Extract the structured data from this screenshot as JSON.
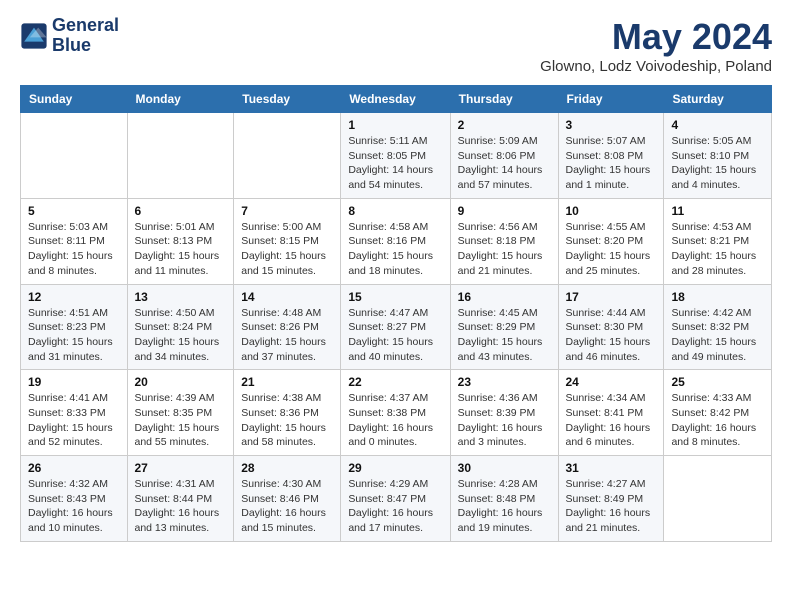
{
  "header": {
    "logo_line1": "General",
    "logo_line2": "Blue",
    "month_year": "May 2024",
    "location": "Glowno, Lodz Voivodeship, Poland"
  },
  "days_of_week": [
    "Sunday",
    "Monday",
    "Tuesday",
    "Wednesday",
    "Thursday",
    "Friday",
    "Saturday"
  ],
  "weeks": [
    [
      {
        "day": "",
        "sunrise": "",
        "sunset": "",
        "daylight": ""
      },
      {
        "day": "",
        "sunrise": "",
        "sunset": "",
        "daylight": ""
      },
      {
        "day": "",
        "sunrise": "",
        "sunset": "",
        "daylight": ""
      },
      {
        "day": "1",
        "sunrise": "Sunrise: 5:11 AM",
        "sunset": "Sunset: 8:05 PM",
        "daylight": "Daylight: 14 hours and 54 minutes."
      },
      {
        "day": "2",
        "sunrise": "Sunrise: 5:09 AM",
        "sunset": "Sunset: 8:06 PM",
        "daylight": "Daylight: 14 hours and 57 minutes."
      },
      {
        "day": "3",
        "sunrise": "Sunrise: 5:07 AM",
        "sunset": "Sunset: 8:08 PM",
        "daylight": "Daylight: 15 hours and 1 minute."
      },
      {
        "day": "4",
        "sunrise": "Sunrise: 5:05 AM",
        "sunset": "Sunset: 8:10 PM",
        "daylight": "Daylight: 15 hours and 4 minutes."
      }
    ],
    [
      {
        "day": "5",
        "sunrise": "Sunrise: 5:03 AM",
        "sunset": "Sunset: 8:11 PM",
        "daylight": "Daylight: 15 hours and 8 minutes."
      },
      {
        "day": "6",
        "sunrise": "Sunrise: 5:01 AM",
        "sunset": "Sunset: 8:13 PM",
        "daylight": "Daylight: 15 hours and 11 minutes."
      },
      {
        "day": "7",
        "sunrise": "Sunrise: 5:00 AM",
        "sunset": "Sunset: 8:15 PM",
        "daylight": "Daylight: 15 hours and 15 minutes."
      },
      {
        "day": "8",
        "sunrise": "Sunrise: 4:58 AM",
        "sunset": "Sunset: 8:16 PM",
        "daylight": "Daylight: 15 hours and 18 minutes."
      },
      {
        "day": "9",
        "sunrise": "Sunrise: 4:56 AM",
        "sunset": "Sunset: 8:18 PM",
        "daylight": "Daylight: 15 hours and 21 minutes."
      },
      {
        "day": "10",
        "sunrise": "Sunrise: 4:55 AM",
        "sunset": "Sunset: 8:20 PM",
        "daylight": "Daylight: 15 hours and 25 minutes."
      },
      {
        "day": "11",
        "sunrise": "Sunrise: 4:53 AM",
        "sunset": "Sunset: 8:21 PM",
        "daylight": "Daylight: 15 hours and 28 minutes."
      }
    ],
    [
      {
        "day": "12",
        "sunrise": "Sunrise: 4:51 AM",
        "sunset": "Sunset: 8:23 PM",
        "daylight": "Daylight: 15 hours and 31 minutes."
      },
      {
        "day": "13",
        "sunrise": "Sunrise: 4:50 AM",
        "sunset": "Sunset: 8:24 PM",
        "daylight": "Daylight: 15 hours and 34 minutes."
      },
      {
        "day": "14",
        "sunrise": "Sunrise: 4:48 AM",
        "sunset": "Sunset: 8:26 PM",
        "daylight": "Daylight: 15 hours and 37 minutes."
      },
      {
        "day": "15",
        "sunrise": "Sunrise: 4:47 AM",
        "sunset": "Sunset: 8:27 PM",
        "daylight": "Daylight: 15 hours and 40 minutes."
      },
      {
        "day": "16",
        "sunrise": "Sunrise: 4:45 AM",
        "sunset": "Sunset: 8:29 PM",
        "daylight": "Daylight: 15 hours and 43 minutes."
      },
      {
        "day": "17",
        "sunrise": "Sunrise: 4:44 AM",
        "sunset": "Sunset: 8:30 PM",
        "daylight": "Daylight: 15 hours and 46 minutes."
      },
      {
        "day": "18",
        "sunrise": "Sunrise: 4:42 AM",
        "sunset": "Sunset: 8:32 PM",
        "daylight": "Daylight: 15 hours and 49 minutes."
      }
    ],
    [
      {
        "day": "19",
        "sunrise": "Sunrise: 4:41 AM",
        "sunset": "Sunset: 8:33 PM",
        "daylight": "Daylight: 15 hours and 52 minutes."
      },
      {
        "day": "20",
        "sunrise": "Sunrise: 4:39 AM",
        "sunset": "Sunset: 8:35 PM",
        "daylight": "Daylight: 15 hours and 55 minutes."
      },
      {
        "day": "21",
        "sunrise": "Sunrise: 4:38 AM",
        "sunset": "Sunset: 8:36 PM",
        "daylight": "Daylight: 15 hours and 58 minutes."
      },
      {
        "day": "22",
        "sunrise": "Sunrise: 4:37 AM",
        "sunset": "Sunset: 8:38 PM",
        "daylight": "Daylight: 16 hours and 0 minutes."
      },
      {
        "day": "23",
        "sunrise": "Sunrise: 4:36 AM",
        "sunset": "Sunset: 8:39 PM",
        "daylight": "Daylight: 16 hours and 3 minutes."
      },
      {
        "day": "24",
        "sunrise": "Sunrise: 4:34 AM",
        "sunset": "Sunset: 8:41 PM",
        "daylight": "Daylight: 16 hours and 6 minutes."
      },
      {
        "day": "25",
        "sunrise": "Sunrise: 4:33 AM",
        "sunset": "Sunset: 8:42 PM",
        "daylight": "Daylight: 16 hours and 8 minutes."
      }
    ],
    [
      {
        "day": "26",
        "sunrise": "Sunrise: 4:32 AM",
        "sunset": "Sunset: 8:43 PM",
        "daylight": "Daylight: 16 hours and 10 minutes."
      },
      {
        "day": "27",
        "sunrise": "Sunrise: 4:31 AM",
        "sunset": "Sunset: 8:44 PM",
        "daylight": "Daylight: 16 hours and 13 minutes."
      },
      {
        "day": "28",
        "sunrise": "Sunrise: 4:30 AM",
        "sunset": "Sunset: 8:46 PM",
        "daylight": "Daylight: 16 hours and 15 minutes."
      },
      {
        "day": "29",
        "sunrise": "Sunrise: 4:29 AM",
        "sunset": "Sunset: 8:47 PM",
        "daylight": "Daylight: 16 hours and 17 minutes."
      },
      {
        "day": "30",
        "sunrise": "Sunrise: 4:28 AM",
        "sunset": "Sunset: 8:48 PM",
        "daylight": "Daylight: 16 hours and 19 minutes."
      },
      {
        "day": "31",
        "sunrise": "Sunrise: 4:27 AM",
        "sunset": "Sunset: 8:49 PM",
        "daylight": "Daylight: 16 hours and 21 minutes."
      },
      {
        "day": "",
        "sunrise": "",
        "sunset": "",
        "daylight": ""
      }
    ]
  ]
}
